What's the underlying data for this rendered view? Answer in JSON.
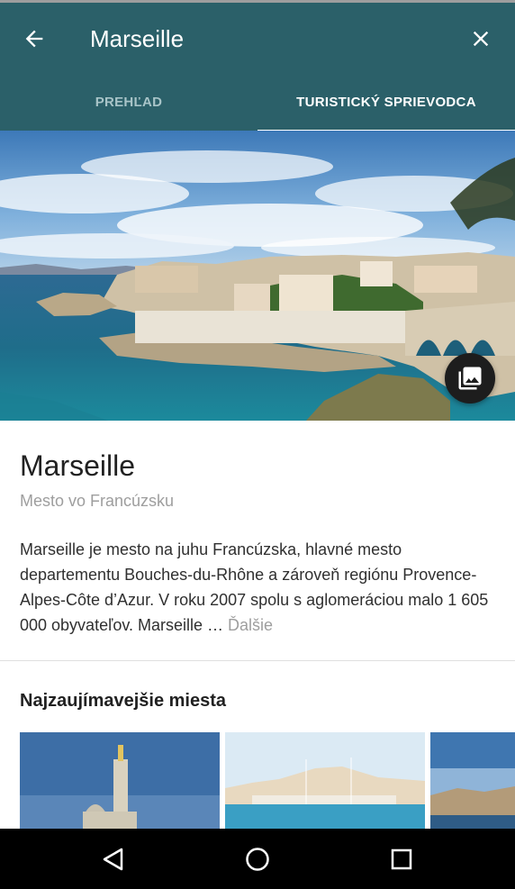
{
  "appbar": {
    "title": "Marseille",
    "back_icon": "arrow-back-icon",
    "close_icon": "close-icon",
    "color": "#2b6069"
  },
  "tabs": [
    {
      "label": "PREHĽAD",
      "active": false
    },
    {
      "label": "TURISTICKÝ SPRIEVODCA",
      "active": true
    }
  ],
  "place": {
    "name": "Marseille",
    "subtitle": "Mesto vo Francúzsku",
    "description": "Marseille je mesto na juhu Francúzska, hlavné mesto departementu Bouches-du-Rhône a zároveň regiónu Provence-Alpes-Côte d’Azur. V roku 2007 spolu s aglomeráciou malo 1 605 000 obyvateľov. Marseille … ",
    "more_label": "Ďalšie"
  },
  "gallery_icon": "photo-library-icon",
  "section": {
    "title": "Najzaujímavejšie miesta"
  },
  "navbar": {
    "icons": [
      "back-triangle-icon",
      "home-circle-icon",
      "recents-square-icon"
    ]
  }
}
